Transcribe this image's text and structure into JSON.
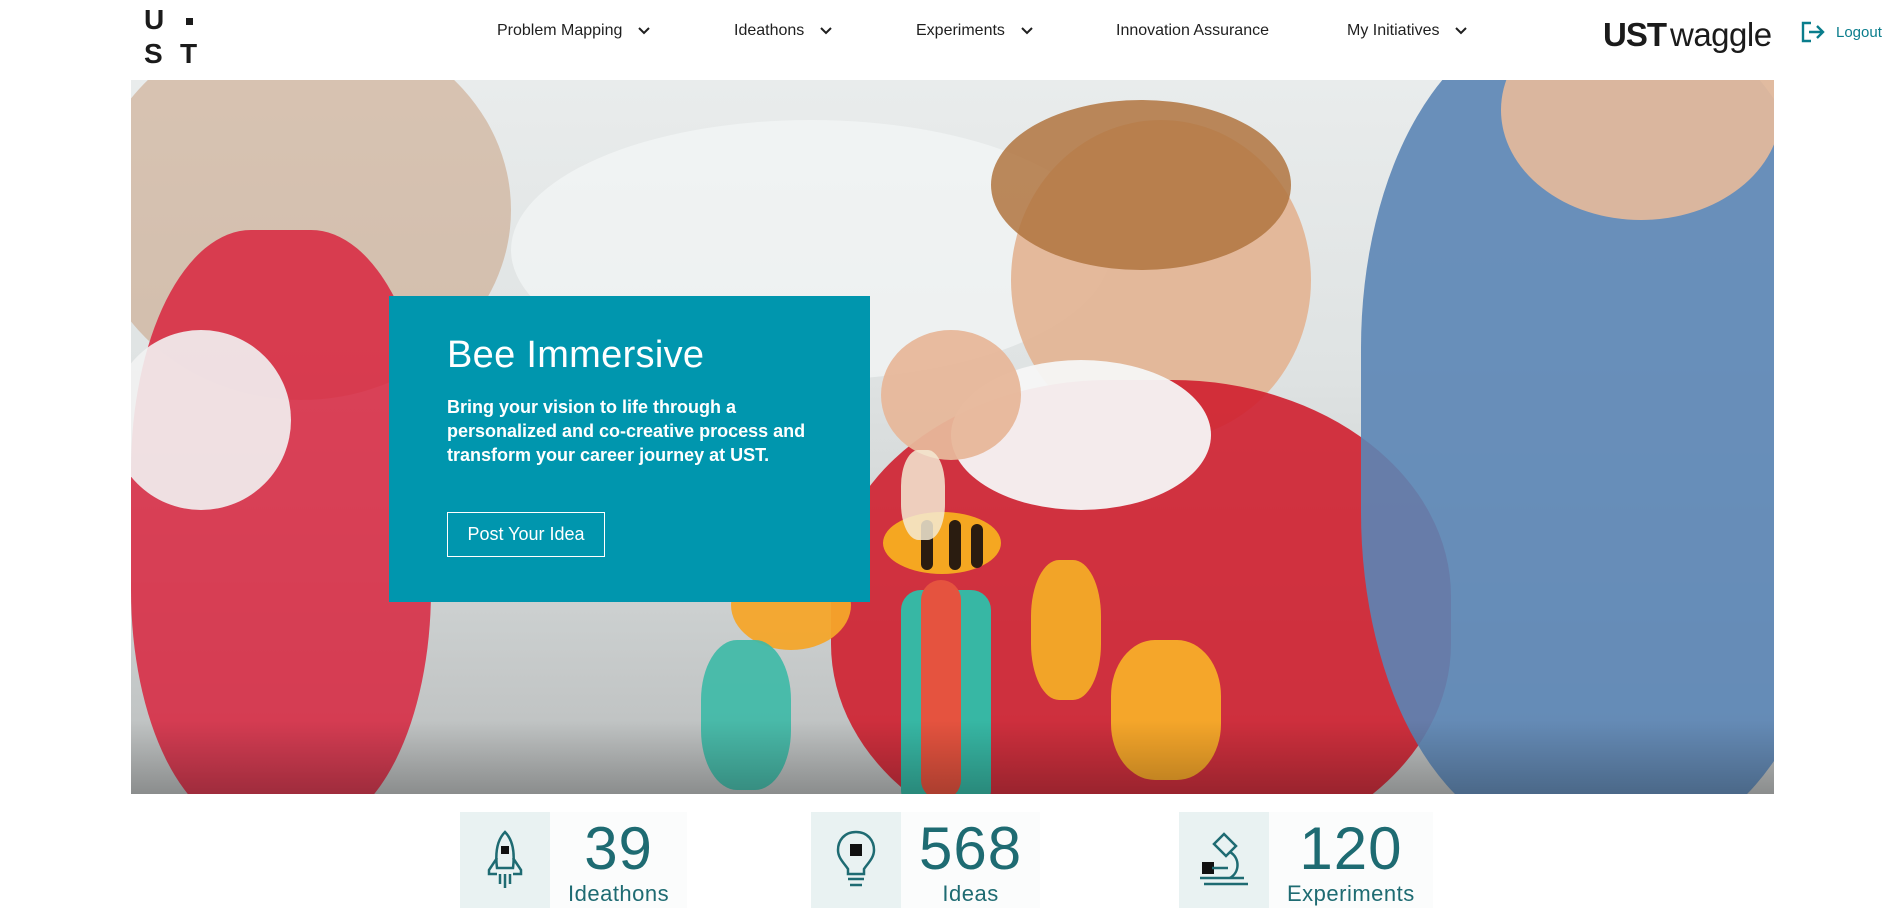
{
  "header": {
    "logo_letters": [
      "U",
      "S",
      "T"
    ],
    "nav": [
      {
        "label": "Problem Mapping",
        "dropdown": true
      },
      {
        "label": "Ideathons",
        "dropdown": true
      },
      {
        "label": "Experiments",
        "dropdown": true
      },
      {
        "label": "Innovation Assurance",
        "dropdown": false
      },
      {
        "label": "My Initiatives",
        "dropdown": true
      }
    ],
    "brand_bold": "UST",
    "brand_light": "waggle",
    "logout_label": "Logout"
  },
  "hero": {
    "title": "Bee Immersive",
    "description": "Bring your vision to life through a personalized and co-creative process and transform your career journey at UST.",
    "cta_label": "Post Your Idea"
  },
  "stats": [
    {
      "value": "39",
      "label": "Ideathons",
      "icon": "rocket-icon"
    },
    {
      "value": "568",
      "label": "Ideas",
      "icon": "lightbulb-icon"
    },
    {
      "value": "120",
      "label": "Experiments",
      "icon": "microscope-icon"
    }
  ],
  "colors": {
    "accent": "#0096ae",
    "stat_text": "#1e6b72",
    "logout": "#0a7d8c"
  }
}
